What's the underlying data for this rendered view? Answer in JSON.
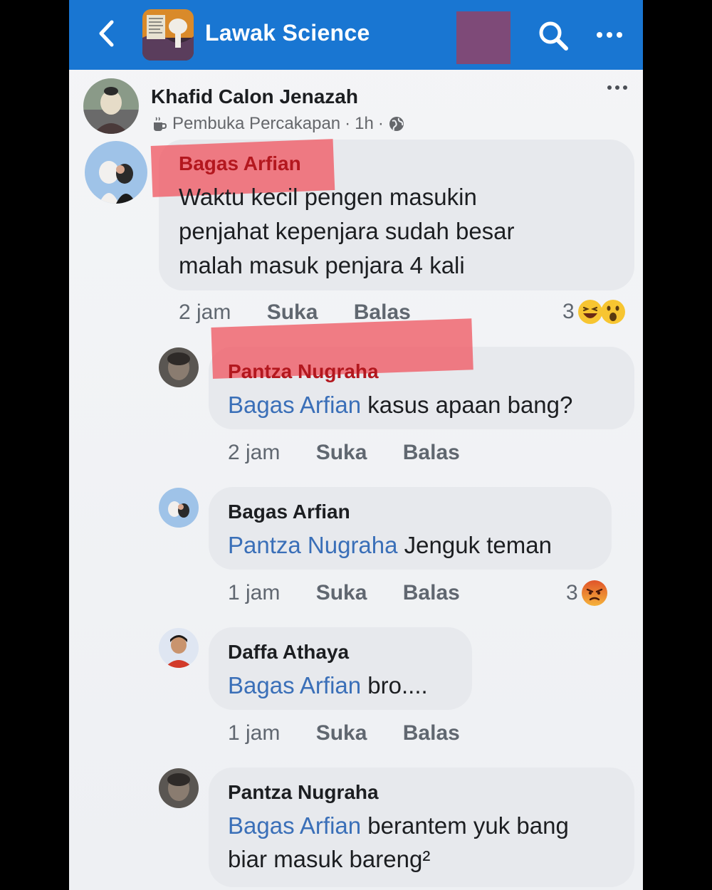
{
  "header": {
    "title": "Lawak Science"
  },
  "post": {
    "author": "Khafid Calon Jenazah",
    "badge": "Pembuka Percakapan",
    "time": "1h",
    "separator": "·"
  },
  "comments": [
    {
      "name": "Bagas Arfian",
      "text_lines": [
        "Waktu kecil pengen masukin",
        "penjahat kepenjara sudah besar",
        "malah masuk penjara 4 kali"
      ],
      "time": "2 jam",
      "like": "Suka",
      "reply": "Balas",
      "reaction_count": "3",
      "reactions": [
        "laughing-emoji",
        "wow-emoji"
      ]
    },
    {
      "name": "Pantza Nugraha",
      "mention": "Bagas Arfian",
      "text": " kasus apaan bang?",
      "time": "2 jam",
      "like": "Suka",
      "reply": "Balas"
    },
    {
      "name": "Bagas Arfian",
      "mention": "Pantza Nugraha",
      "text": " Jenguk teman",
      "time": "1 jam",
      "like": "Suka",
      "reply": "Balas",
      "reaction_count": "3",
      "reactions": [
        "angry-emoji"
      ]
    },
    {
      "name": "Daffa Athaya",
      "mention": "Bagas Arfian",
      "text": " bro....",
      "time": "1 jam",
      "like": "Suka",
      "reply": "Balas"
    },
    {
      "name": "Pantza Nugraha",
      "mention": "Bagas Arfian",
      "text": " berantem yuk bang",
      "text_line2": "biar masuk bareng²"
    }
  ],
  "colors": {
    "topbar": "#1976d2",
    "bubble": "#e7e9ed",
    "mention": "#3a6fb8",
    "highlight": "#f05a64"
  }
}
